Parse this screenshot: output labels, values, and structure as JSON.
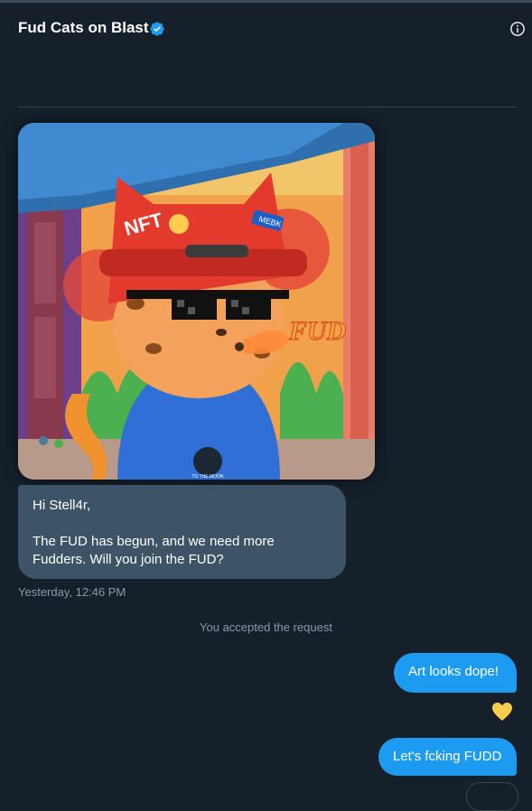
{
  "header": {
    "title": "Fud Cats on Blast",
    "verified_icon": "verified-badge-icon",
    "info_icon": "info-icon"
  },
  "artwork": {
    "cap_text": "NFT",
    "cap_badge": "MEBK",
    "hoodie_text": "TO THE MOON",
    "breath_text": "FUD"
  },
  "messages": {
    "incoming": {
      "greeting": "Hi Stell4r,",
      "body": "The FUD has begun, and we need more Fudders. Will you join the FUD?",
      "timestamp": "Yesterday, 12:46 PM"
    },
    "system": "You accepted the request",
    "outgoing": [
      {
        "text": "Art looks dope!"
      },
      {
        "text": "Let's fcking FUDD"
      }
    ],
    "reaction": "yellow-heart-icon"
  },
  "colors": {
    "background": "#15202b",
    "bubble_in": "#3d5466",
    "bubble_out": "#1d9bf0",
    "verified": "#1d9bf0",
    "heart": "#ffcc4d"
  }
}
